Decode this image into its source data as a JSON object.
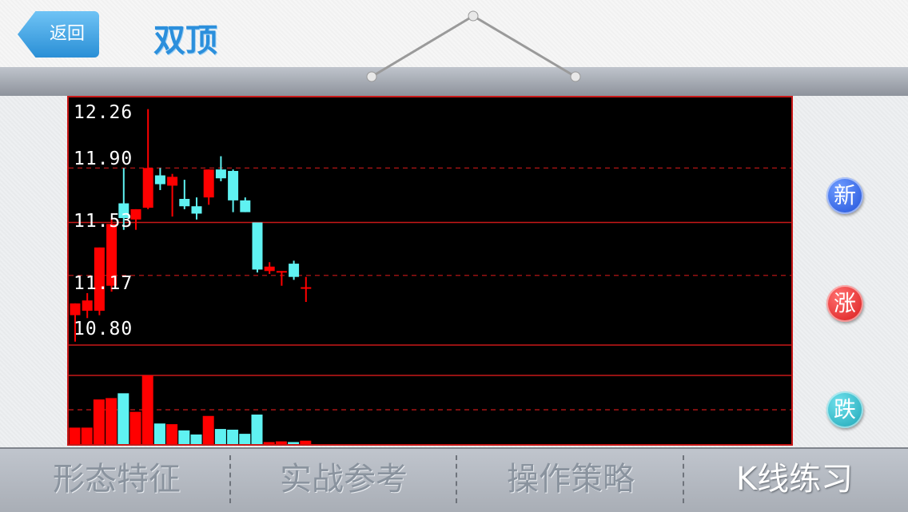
{
  "header": {
    "back_label": "返回",
    "title": "双顶"
  },
  "colors": {
    "up": "#ff0000",
    "down": "#5ff2f2",
    "grid": "#c81818",
    "title": "#2b8fdc",
    "new_button": "#1e4fd8",
    "rise_button": "#d81818",
    "fall_button": "#1aa4b4"
  },
  "side_buttons": {
    "new_label": "新",
    "rise_label": "涨",
    "fall_label": "跌"
  },
  "tabs": [
    {
      "label": "形态特征",
      "active": false
    },
    {
      "label": "实战参考",
      "active": false
    },
    {
      "label": "操作策略",
      "active": false
    },
    {
      "label": "K线练习",
      "active": true
    }
  ],
  "chart_data": {
    "type": "candlestick",
    "price_labels": [
      "12.26",
      "11.90",
      "11.53",
      "11.17",
      "10.80"
    ],
    "ylim": [
      10.8,
      12.26
    ],
    "candles": [
      {
        "open": 10.9,
        "close": 10.98,
        "high": 10.98,
        "low": 10.72
      },
      {
        "open": 10.93,
        "close": 11.0,
        "high": 11.05,
        "low": 10.88
      },
      {
        "open": 10.93,
        "close": 11.36,
        "high": 11.36,
        "low": 10.9
      },
      {
        "open": 11.1,
        "close": 11.52,
        "high": 11.56,
        "low": 11.06
      },
      {
        "open": 11.66,
        "close": 11.56,
        "high": 11.9,
        "low": 11.48
      },
      {
        "open": 11.55,
        "close": 11.62,
        "high": 11.62,
        "low": 11.48
      },
      {
        "open": 11.63,
        "close": 11.9,
        "high": 12.3,
        "low": 11.62
      },
      {
        "open": 11.85,
        "close": 11.79,
        "high": 11.9,
        "low": 11.75
      },
      {
        "open": 11.78,
        "close": 11.84,
        "high": 11.86,
        "low": 11.57
      },
      {
        "open": 11.69,
        "close": 11.64,
        "high": 11.82,
        "low": 11.62
      },
      {
        "open": 11.64,
        "close": 11.59,
        "high": 11.7,
        "low": 11.55
      },
      {
        "open": 11.7,
        "close": 11.89,
        "high": 11.89,
        "low": 11.65
      },
      {
        "open": 11.89,
        "close": 11.83,
        "high": 11.98,
        "low": 11.81
      },
      {
        "open": 11.88,
        "close": 11.68,
        "high": 11.89,
        "low": 11.6
      },
      {
        "open": 11.68,
        "close": 11.6,
        "high": 11.7,
        "low": 11.6
      },
      {
        "open": 11.53,
        "close": 11.21,
        "high": 11.53,
        "low": 11.19
      },
      {
        "open": 11.2,
        "close": 11.23,
        "high": 11.26,
        "low": 11.18
      },
      {
        "open": 11.2,
        "close": 11.2,
        "high": 11.2,
        "low": 11.1
      },
      {
        "open": 11.25,
        "close": 11.16,
        "high": 11.27,
        "low": 11.14
      },
      {
        "open": 11.09,
        "close": 11.09,
        "high": 11.16,
        "low": 10.99
      }
    ],
    "volume": {
      "ylim": [
        0,
        100
      ],
      "values": [
        24,
        24,
        65,
        67,
        74,
        47,
        100,
        30,
        29,
        20,
        14,
        41,
        22,
        21,
        15,
        43,
        3,
        4,
        3,
        5
      ]
    }
  }
}
